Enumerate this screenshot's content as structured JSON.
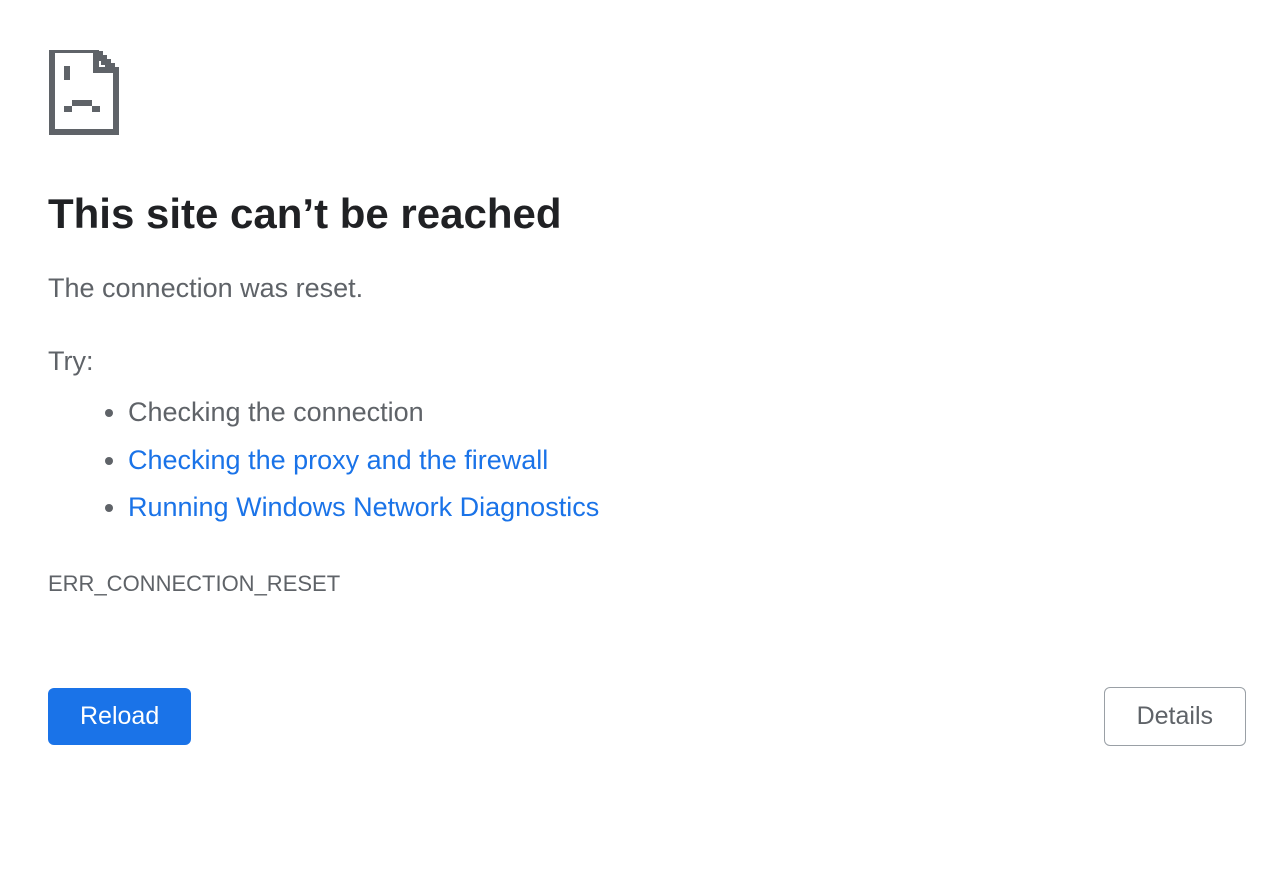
{
  "heading": "This site can’t be reached",
  "message": "The connection was reset.",
  "try_label": "Try:",
  "suggestions": [
    {
      "text": "Checking the connection",
      "is_link": false
    },
    {
      "text": "Checking the proxy and the firewall",
      "is_link": true
    },
    {
      "text": "Running Windows Network Diagnostics",
      "is_link": true
    }
  ],
  "error_code": "ERR_CONNECTION_RESET",
  "buttons": {
    "reload": "Reload",
    "details": "Details"
  }
}
